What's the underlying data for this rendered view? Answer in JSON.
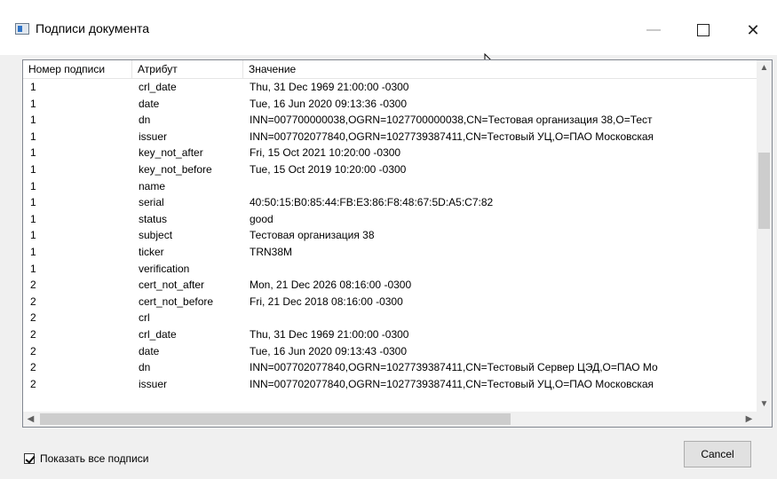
{
  "window": {
    "title": "Подписи документа",
    "icon": "dialog-icon"
  },
  "table": {
    "columns": [
      "Номер подписи",
      "Атрибут",
      "Значение"
    ],
    "rows": [
      [
        "1",
        "crl_date",
        "Thu, 31 Dec 1969 21:00:00 -0300"
      ],
      [
        "1",
        "date",
        "Tue, 16 Jun 2020 09:13:36 -0300"
      ],
      [
        "1",
        "dn",
        "INN=007700000038,OGRN=1027700000038,CN=Тестовая организация 38,O=Тест"
      ],
      [
        "1",
        "issuer",
        "INN=007702077840,OGRN=1027739387411,CN=Тестовый УЦ,O=ПАО Московская"
      ],
      [
        "1",
        "key_not_after",
        "Fri, 15 Oct 2021 10:20:00 -0300"
      ],
      [
        "1",
        "key_not_before",
        "Tue, 15 Oct 2019 10:20:00 -0300"
      ],
      [
        "1",
        "name",
        ""
      ],
      [
        "1",
        "serial",
        "40:50:15:B0:85:44:FB:E3:86:F8:48:67:5D:A5:C7:82"
      ],
      [
        "1",
        "status",
        "good"
      ],
      [
        "1",
        "subject",
        "Тестовая организация 38"
      ],
      [
        "1",
        "ticker",
        "TRN38M"
      ],
      [
        "1",
        "verification",
        ""
      ],
      [
        "2",
        "cert_not_after",
        "Mon, 21 Dec 2026 08:16:00 -0300"
      ],
      [
        "2",
        "cert_not_before",
        "Fri, 21 Dec 2018 08:16:00 -0300"
      ],
      [
        "2",
        "crl",
        ""
      ],
      [
        "2",
        "crl_date",
        "Thu, 31 Dec 1969 21:00:00 -0300"
      ],
      [
        "2",
        "date",
        "Tue, 16 Jun 2020 09:13:43 -0300"
      ],
      [
        "2",
        "dn",
        "INN=007702077840,OGRN=1027739387411,CN=Тестовый Сервер ЦЭД,O=ПАО Мо"
      ],
      [
        "2",
        "issuer",
        "INN=007702077840,OGRN=1027739387411,CN=Тестовый УЦ,O=ПАО Московская"
      ]
    ]
  },
  "footer": {
    "show_all_label": "Показать все подписи",
    "show_all_checked": true,
    "cancel_label": "Cancel"
  }
}
